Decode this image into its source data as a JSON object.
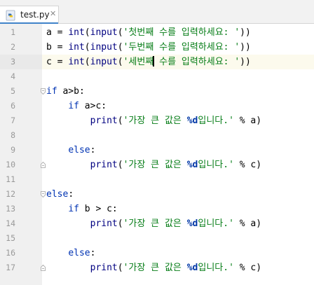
{
  "tab": {
    "filename": "test.py",
    "close_glyph": "✕",
    "icon": "python-file-icon",
    "accent": "#4083c9"
  },
  "editor": {
    "current_line": 3,
    "lines": [
      {
        "number": "1",
        "segments": [
          [
            "",
            "a = "
          ],
          [
            "bi",
            "int"
          ],
          [
            "",
            "("
          ],
          [
            "bi",
            "input"
          ],
          [
            "",
            "("
          ],
          [
            "str",
            "'첫번째 수를 입력하세요: '"
          ],
          [
            "",
            "))"
          ]
        ]
      },
      {
        "number": "2",
        "segments": [
          [
            "",
            "b = "
          ],
          [
            "bi",
            "int"
          ],
          [
            "",
            "("
          ],
          [
            "bi",
            "input"
          ],
          [
            "",
            "("
          ],
          [
            "str",
            "'두번째 수를 입력하세요: '"
          ],
          [
            "",
            "))"
          ]
        ]
      },
      {
        "number": "3",
        "segments": [
          [
            "",
            "c = "
          ],
          [
            "bi",
            "int"
          ],
          [
            "",
            "("
          ],
          [
            "bi",
            "input"
          ],
          [
            "",
            "("
          ],
          [
            "str",
            "'세번째"
          ],
          [
            "caret",
            ""
          ],
          [
            "str",
            " 수를 입력하세요: '"
          ],
          [
            "",
            "))"
          ]
        ]
      },
      {
        "number": "4",
        "segments": []
      },
      {
        "number": "5",
        "segments": [
          [
            "kw",
            "if"
          ],
          [
            "",
            " a>b:"
          ]
        ]
      },
      {
        "number": "6",
        "segments": [
          [
            "",
            "    "
          ],
          [
            "kw",
            "if"
          ],
          [
            "",
            " a>c:"
          ]
        ]
      },
      {
        "number": "7",
        "segments": [
          [
            "",
            "        "
          ],
          [
            "bi",
            "print"
          ],
          [
            "",
            "("
          ],
          [
            "str",
            "'가장 큰 값은 "
          ],
          [
            "fmt",
            "%d"
          ],
          [
            "str",
            "입니다.'"
          ],
          [
            "",
            " % a)"
          ]
        ]
      },
      {
        "number": "8",
        "segments": []
      },
      {
        "number": "9",
        "segments": [
          [
            "",
            "    "
          ],
          [
            "kw",
            "else"
          ],
          [
            "",
            ":"
          ]
        ]
      },
      {
        "number": "10",
        "segments": [
          [
            "",
            "        "
          ],
          [
            "bi",
            "print"
          ],
          [
            "",
            "("
          ],
          [
            "str",
            "'가장 큰 값은 "
          ],
          [
            "fmt",
            "%d"
          ],
          [
            "str",
            "입니다.'"
          ],
          [
            "",
            " % c)"
          ]
        ]
      },
      {
        "number": "11",
        "segments": []
      },
      {
        "number": "12",
        "segments": [
          [
            "kw",
            "else"
          ],
          [
            "",
            ":"
          ]
        ]
      },
      {
        "number": "13",
        "segments": [
          [
            "",
            "    "
          ],
          [
            "kw",
            "if"
          ],
          [
            "",
            " b > c:"
          ]
        ]
      },
      {
        "number": "14",
        "segments": [
          [
            "",
            "        "
          ],
          [
            "bi",
            "print"
          ],
          [
            "",
            "("
          ],
          [
            "str",
            "'가장 큰 값은 "
          ],
          [
            "fmt",
            "%d"
          ],
          [
            "str",
            "입니다.'"
          ],
          [
            "",
            " % a)"
          ]
        ]
      },
      {
        "number": "15",
        "segments": []
      },
      {
        "number": "16",
        "segments": [
          [
            "",
            "    "
          ],
          [
            "kw",
            "else"
          ],
          [
            "",
            ":"
          ]
        ]
      },
      {
        "number": "17",
        "segments": [
          [
            "",
            "        "
          ],
          [
            "bi",
            "print"
          ],
          [
            "",
            "("
          ],
          [
            "str",
            "'가장 큰 값은 "
          ],
          [
            "fmt",
            "%d"
          ],
          [
            "str",
            "입니다.'"
          ],
          [
            "",
            " % c)"
          ]
        ]
      }
    ],
    "fold_markers": [
      {
        "line": 5,
        "kind": "start"
      },
      {
        "line": 10,
        "kind": "end"
      },
      {
        "line": 12,
        "kind": "start"
      },
      {
        "line": 17,
        "kind": "end"
      }
    ],
    "colors": {
      "keyword": "#0033b3",
      "builtin": "#000080",
      "string": "#067d17",
      "format_spec": "#0037a6",
      "current_line_bg": "#fcfaed"
    }
  }
}
